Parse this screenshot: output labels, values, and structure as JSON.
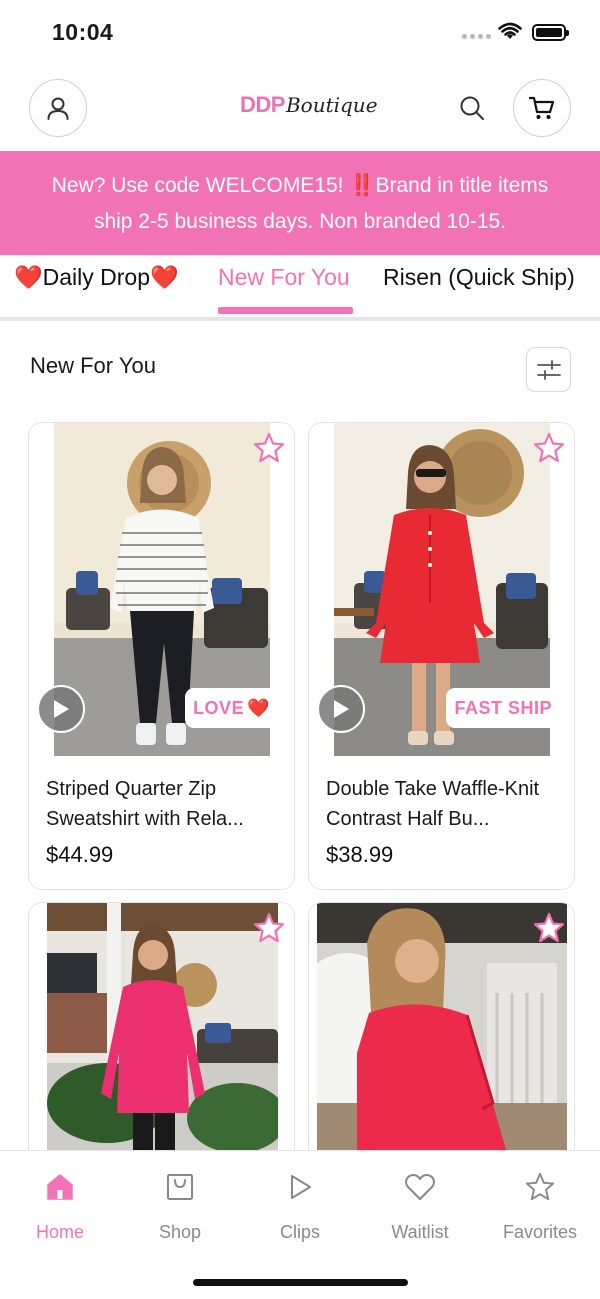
{
  "status_bar": {
    "time": "10:04"
  },
  "header": {
    "logo_ddp": "DDP",
    "logo_boutique": "Boutique",
    "profile_icon": "person-icon",
    "search_icon": "search-icon",
    "cart_icon": "cart-icon"
  },
  "banner": {
    "line1_prefix": "New? Use code WELCOME15! ",
    "line1_bang": "‼️",
    "line1_suffix": "Brand in title items",
    "line2": "ship 2-5 business days. Non branded 10-15."
  },
  "tabs": {
    "daily_drop": {
      "heart_left": "❤️",
      "label": "Daily Drop",
      "heart_right": "❤️"
    },
    "new_for_you": "New For You",
    "risen": "Risen (Quick Ship)",
    "active": "New For You"
  },
  "section": {
    "title": "New For You",
    "filter_icon": "sliders-icon"
  },
  "products": [
    {
      "name": "Striped Quarter Zip Sweatshirt with Rela...",
      "price": "$44.99",
      "tag": "LOVE",
      "tag_emoji": "❤️",
      "has_video": true
    },
    {
      "name": "Double Take Waffle-Knit Contrast Half Bu...",
      "price": "$38.99",
      "tag": "FAST SHIP",
      "tag_emoji": "",
      "has_video": true
    },
    {
      "name": "",
      "price": "",
      "tag": "",
      "has_video": false
    },
    {
      "name": "",
      "price": "",
      "tag": "",
      "has_video": false
    }
  ],
  "bottom_nav": {
    "home": "Home",
    "shop": "Shop",
    "clips": "Clips",
    "waitlist": "Waitlist",
    "favorites": "Favorites",
    "active": "Home"
  },
  "colors": {
    "brand_pink": "#f272b6",
    "heart_red": "#e0141e",
    "muted_text": "#8a8a8a"
  }
}
